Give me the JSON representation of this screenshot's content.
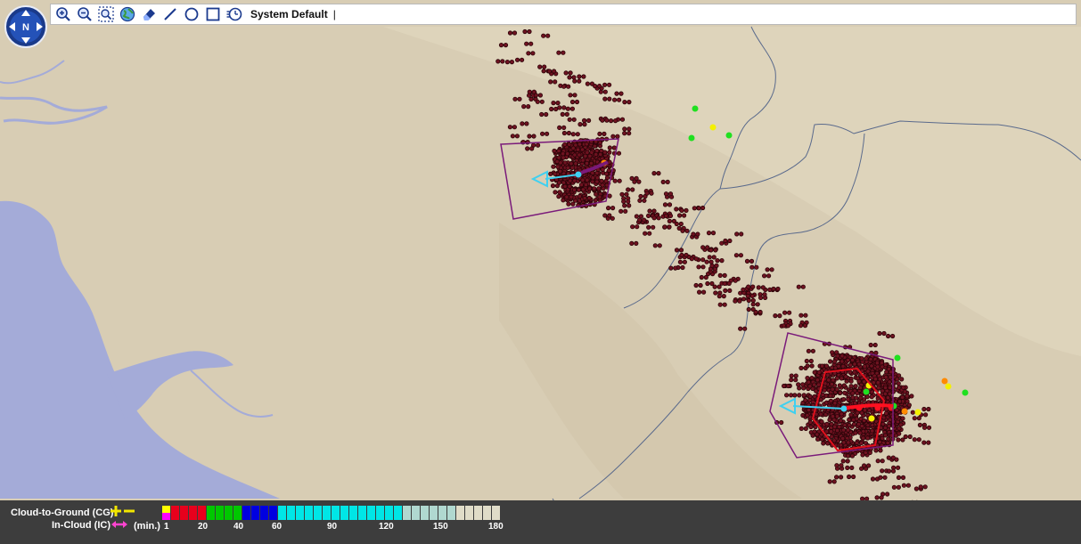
{
  "toolbar": {
    "preset_label": "System Default",
    "caret": "|",
    "tools": [
      {
        "name": "zoom-in-icon"
      },
      {
        "name": "zoom-out-icon"
      },
      {
        "name": "zoom-box-icon"
      },
      {
        "name": "globe-icon"
      },
      {
        "name": "eraser-icon"
      },
      {
        "name": "line-tool-icon"
      },
      {
        "name": "circle-tool-icon"
      },
      {
        "name": "rectangle-tool-icon"
      },
      {
        "name": "time-filter-icon"
      }
    ]
  },
  "compass": {
    "label": "N"
  },
  "legend": {
    "cg_label": "Cloud-to-Ground (CG)",
    "ic_label": "In-Cloud (IC)",
    "units": "(min.)",
    "ticks": [
      "1",
      "20",
      "40",
      "60",
      "90",
      "120",
      "150",
      "180"
    ],
    "colors": {
      "cg_symbol": "#f2e600",
      "ic_symbol": "#ff44d0",
      "bar_first": [
        "#ffff00",
        "#ff00ff"
      ],
      "bar_red": "#e8001c",
      "bar_green": "#00c800",
      "bar_blue": "#0000e0",
      "bar_cyan": "#00e6e6",
      "bar_pale": "#b0d8d0",
      "bar_cream": "#e0dcc8"
    }
  },
  "map": {
    "colors": {
      "land": "#d8cdb4",
      "water": "#a4abd8",
      "border": "#5a6a8c",
      "flash_old": "#6e1220",
      "flash_ring": "#2a0408",
      "polygon": "#7a1a7a",
      "track": "#3fd0f0",
      "recent_red": "#ff1020",
      "recent_orange": "#ff8a00",
      "recent_green": "#20e020",
      "recent_yellow": "#f4f000"
    }
  }
}
